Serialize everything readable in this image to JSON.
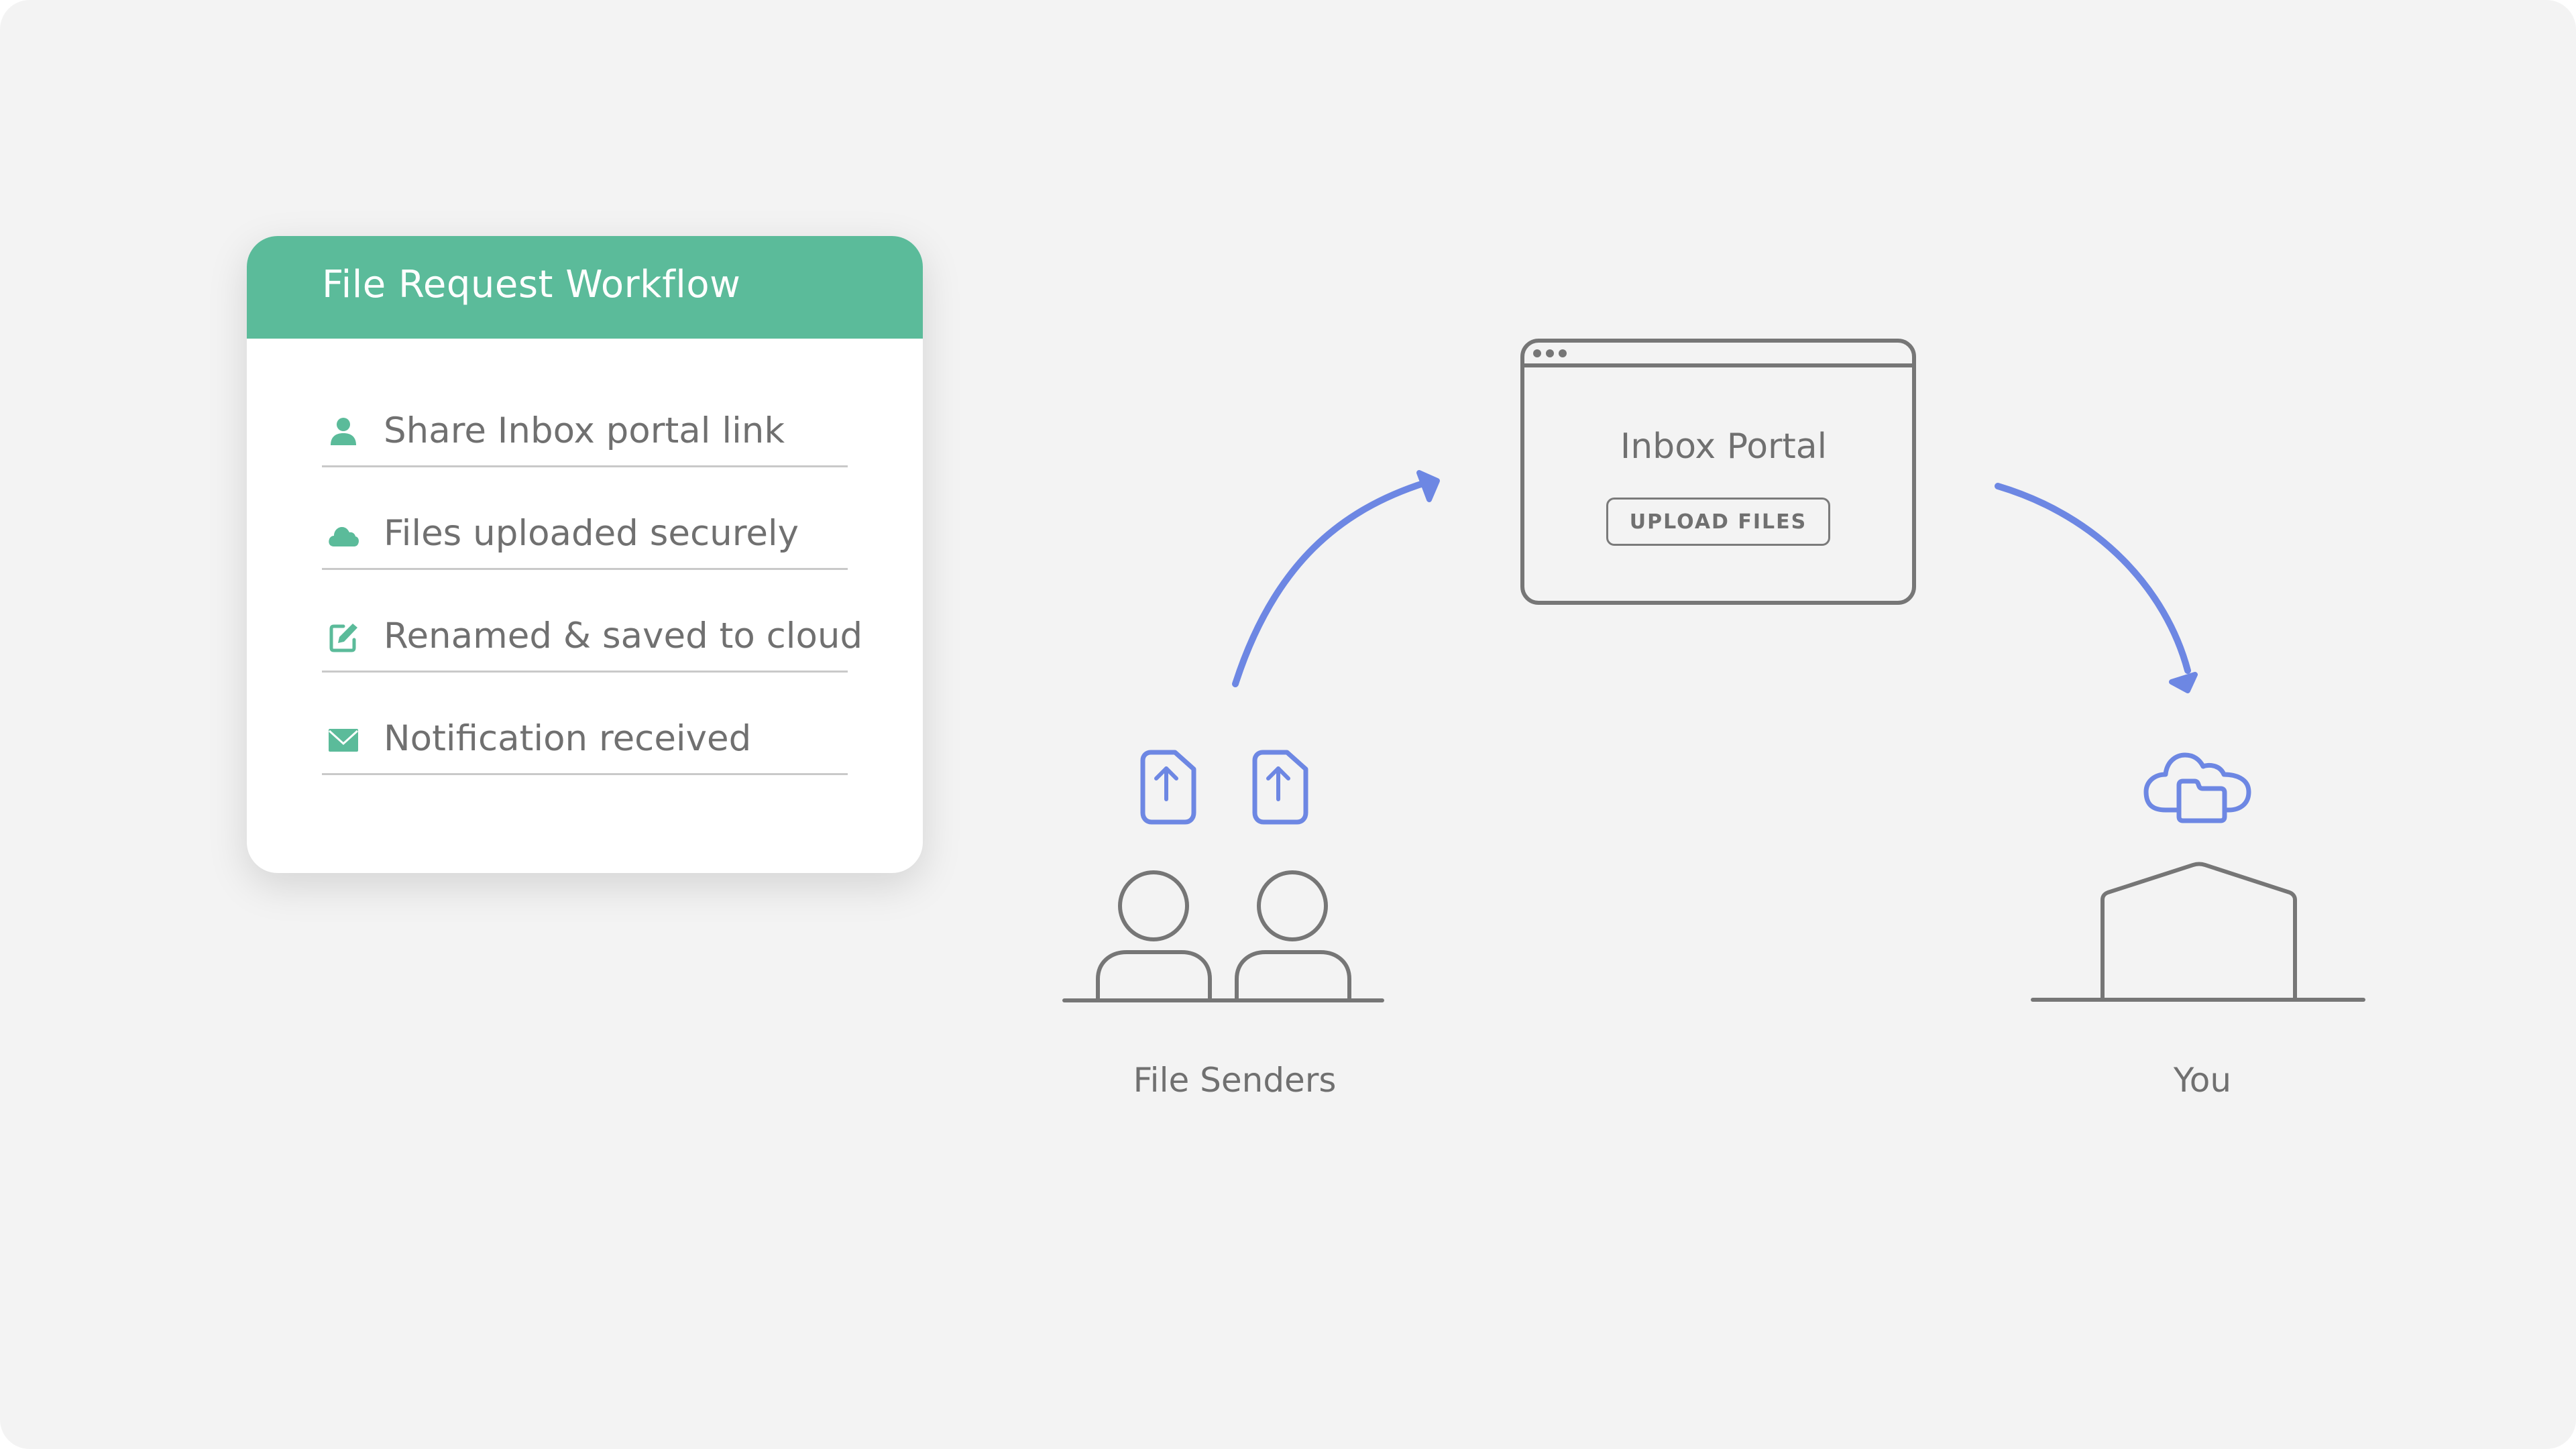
{
  "card": {
    "title": "File Request Workflow",
    "items": [
      {
        "icon": "user-icon",
        "label": "Share Inbox portal link"
      },
      {
        "icon": "cloud-icon",
        "label": "Files uploaded securely"
      },
      {
        "icon": "edit-icon",
        "label": "Renamed & saved to cloud"
      },
      {
        "icon": "mail-icon",
        "label": "Notification received"
      }
    ]
  },
  "portal": {
    "title": "Inbox Portal",
    "button_label": "UPLOAD FILES"
  },
  "senders": {
    "caption": "File Senders"
  },
  "recipient": {
    "caption": "You"
  },
  "colors": {
    "accent_green": "#5bbb9a",
    "accent_blue": "#6d87e3",
    "line_gray": "#767676",
    "background": "#f3f3f3"
  }
}
